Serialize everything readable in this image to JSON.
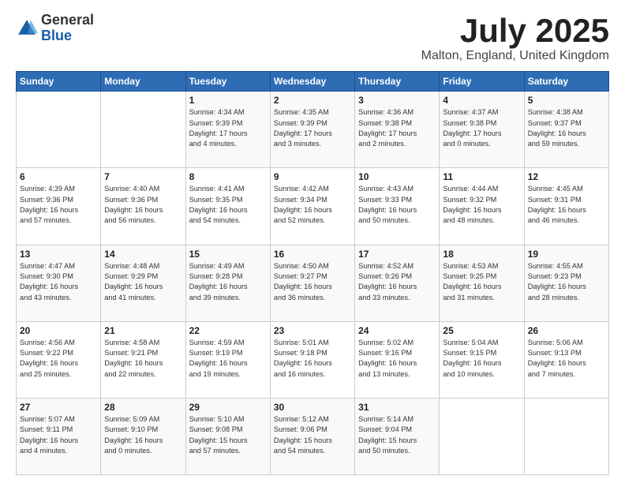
{
  "header": {
    "logo_general": "General",
    "logo_blue": "Blue",
    "title": "July 2025",
    "subtitle": "Malton, England, United Kingdom"
  },
  "calendar": {
    "days_of_week": [
      "Sunday",
      "Monday",
      "Tuesday",
      "Wednesday",
      "Thursday",
      "Friday",
      "Saturday"
    ],
    "weeks": [
      [
        {
          "day": "",
          "info": ""
        },
        {
          "day": "",
          "info": ""
        },
        {
          "day": "1",
          "info": "Sunrise: 4:34 AM\nSunset: 9:39 PM\nDaylight: 17 hours\nand 4 minutes."
        },
        {
          "day": "2",
          "info": "Sunrise: 4:35 AM\nSunset: 9:39 PM\nDaylight: 17 hours\nand 3 minutes."
        },
        {
          "day": "3",
          "info": "Sunrise: 4:36 AM\nSunset: 9:38 PM\nDaylight: 17 hours\nand 2 minutes."
        },
        {
          "day": "4",
          "info": "Sunrise: 4:37 AM\nSunset: 9:38 PM\nDaylight: 17 hours\nand 0 minutes."
        },
        {
          "day": "5",
          "info": "Sunrise: 4:38 AM\nSunset: 9:37 PM\nDaylight: 16 hours\nand 59 minutes."
        }
      ],
      [
        {
          "day": "6",
          "info": "Sunrise: 4:39 AM\nSunset: 9:36 PM\nDaylight: 16 hours\nand 57 minutes."
        },
        {
          "day": "7",
          "info": "Sunrise: 4:40 AM\nSunset: 9:36 PM\nDaylight: 16 hours\nand 56 minutes."
        },
        {
          "day": "8",
          "info": "Sunrise: 4:41 AM\nSunset: 9:35 PM\nDaylight: 16 hours\nand 54 minutes."
        },
        {
          "day": "9",
          "info": "Sunrise: 4:42 AM\nSunset: 9:34 PM\nDaylight: 16 hours\nand 52 minutes."
        },
        {
          "day": "10",
          "info": "Sunrise: 4:43 AM\nSunset: 9:33 PM\nDaylight: 16 hours\nand 50 minutes."
        },
        {
          "day": "11",
          "info": "Sunrise: 4:44 AM\nSunset: 9:32 PM\nDaylight: 16 hours\nand 48 minutes."
        },
        {
          "day": "12",
          "info": "Sunrise: 4:45 AM\nSunset: 9:31 PM\nDaylight: 16 hours\nand 46 minutes."
        }
      ],
      [
        {
          "day": "13",
          "info": "Sunrise: 4:47 AM\nSunset: 9:30 PM\nDaylight: 16 hours\nand 43 minutes."
        },
        {
          "day": "14",
          "info": "Sunrise: 4:48 AM\nSunset: 9:29 PM\nDaylight: 16 hours\nand 41 minutes."
        },
        {
          "day": "15",
          "info": "Sunrise: 4:49 AM\nSunset: 9:28 PM\nDaylight: 16 hours\nand 39 minutes."
        },
        {
          "day": "16",
          "info": "Sunrise: 4:50 AM\nSunset: 9:27 PM\nDaylight: 16 hours\nand 36 minutes."
        },
        {
          "day": "17",
          "info": "Sunrise: 4:52 AM\nSunset: 9:26 PM\nDaylight: 16 hours\nand 33 minutes."
        },
        {
          "day": "18",
          "info": "Sunrise: 4:53 AM\nSunset: 9:25 PM\nDaylight: 16 hours\nand 31 minutes."
        },
        {
          "day": "19",
          "info": "Sunrise: 4:55 AM\nSunset: 9:23 PM\nDaylight: 16 hours\nand 28 minutes."
        }
      ],
      [
        {
          "day": "20",
          "info": "Sunrise: 4:56 AM\nSunset: 9:22 PM\nDaylight: 16 hours\nand 25 minutes."
        },
        {
          "day": "21",
          "info": "Sunrise: 4:58 AM\nSunset: 9:21 PM\nDaylight: 16 hours\nand 22 minutes."
        },
        {
          "day": "22",
          "info": "Sunrise: 4:59 AM\nSunset: 9:19 PM\nDaylight: 16 hours\nand 19 minutes."
        },
        {
          "day": "23",
          "info": "Sunrise: 5:01 AM\nSunset: 9:18 PM\nDaylight: 16 hours\nand 16 minutes."
        },
        {
          "day": "24",
          "info": "Sunrise: 5:02 AM\nSunset: 9:16 PM\nDaylight: 16 hours\nand 13 minutes."
        },
        {
          "day": "25",
          "info": "Sunrise: 5:04 AM\nSunset: 9:15 PM\nDaylight: 16 hours\nand 10 minutes."
        },
        {
          "day": "26",
          "info": "Sunrise: 5:06 AM\nSunset: 9:13 PM\nDaylight: 16 hours\nand 7 minutes."
        }
      ],
      [
        {
          "day": "27",
          "info": "Sunrise: 5:07 AM\nSunset: 9:11 PM\nDaylight: 16 hours\nand 4 minutes."
        },
        {
          "day": "28",
          "info": "Sunrise: 5:09 AM\nSunset: 9:10 PM\nDaylight: 16 hours\nand 0 minutes."
        },
        {
          "day": "29",
          "info": "Sunrise: 5:10 AM\nSunset: 9:08 PM\nDaylight: 15 hours\nand 57 minutes."
        },
        {
          "day": "30",
          "info": "Sunrise: 5:12 AM\nSunset: 9:06 PM\nDaylight: 15 hours\nand 54 minutes."
        },
        {
          "day": "31",
          "info": "Sunrise: 5:14 AM\nSunset: 9:04 PM\nDaylight: 15 hours\nand 50 minutes."
        },
        {
          "day": "",
          "info": ""
        },
        {
          "day": "",
          "info": ""
        }
      ]
    ]
  }
}
